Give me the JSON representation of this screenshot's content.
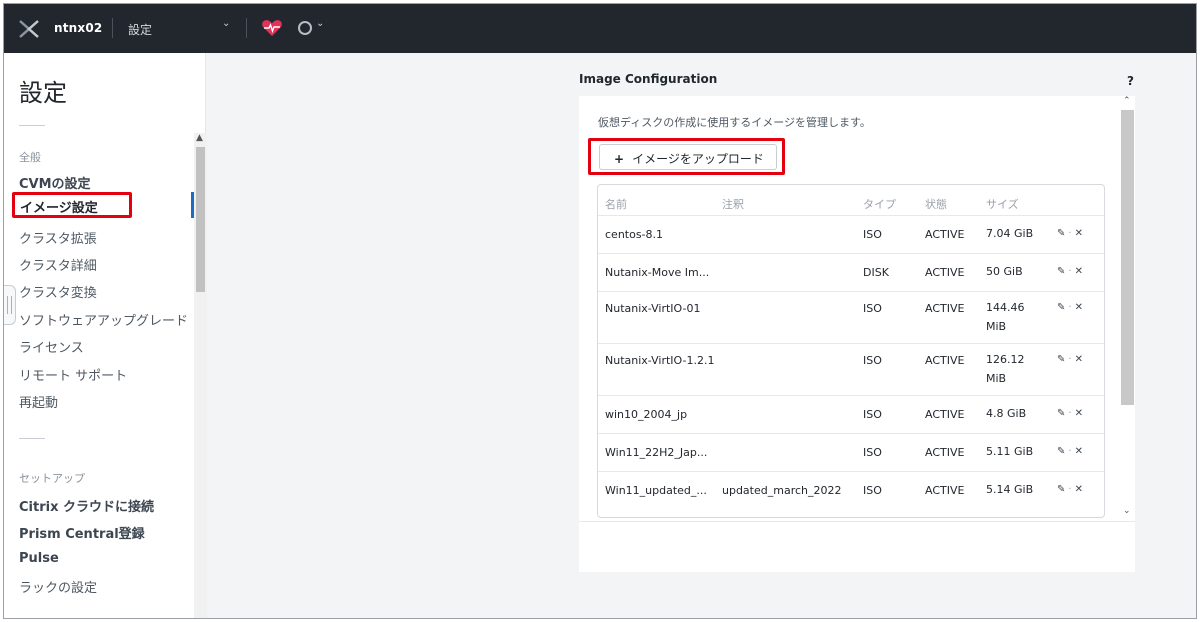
{
  "header": {
    "cluster_name": "ntnx02",
    "page_menu": "設定",
    "caret": "⌄",
    "alert_caret": "⌄",
    "health_color": "#e0335a"
  },
  "sidebar": {
    "title": "設定",
    "group_general": "全般",
    "group_setup": "セットアップ",
    "items": [
      {
        "label": "CVMの設定"
      },
      {
        "label": "イメージ設定"
      },
      {
        "label": "クラスタ拡張"
      },
      {
        "label": "クラスタ詳細"
      },
      {
        "label": "クラスタ変換"
      },
      {
        "label": "ソフトウェアアップグレード"
      },
      {
        "label": "ライセンス"
      },
      {
        "label": "リモート サポート"
      },
      {
        "label": "再起動"
      }
    ],
    "setup_items": [
      {
        "label": "Citrix クラウドに接続"
      },
      {
        "label": "Prism Central登録"
      },
      {
        "label": "Pulse"
      },
      {
        "label": "ラックの設定"
      }
    ],
    "active_color": "#1b6dc1",
    "highlight_color": "#e5000f"
  },
  "main": {
    "panel_title": "Image Configuration",
    "help": "?",
    "description": "仮想ディスクの作成に使用するイメージを管理します。",
    "upload_plus": "+",
    "upload_label": "イメージをアップロード",
    "columns": [
      "名前",
      "注釈",
      "タイプ",
      "状態",
      "サイズ"
    ],
    "rows": [
      {
        "name": "centos-8.1",
        "note": "",
        "type": "ISO",
        "state": "ACTIVE",
        "size": "7.04 GiB"
      },
      {
        "name": "Nutanix-Move Im...",
        "note": "",
        "type": "DISK",
        "state": "ACTIVE",
        "size": "50 GiB"
      },
      {
        "name": "Nutanix-VirtIO-01",
        "note": "",
        "type": "ISO",
        "state": "ACTIVE",
        "size": "144.46 MiB"
      },
      {
        "name": "Nutanix-VirtIO-1.2.1",
        "note": "",
        "type": "ISO",
        "state": "ACTIVE",
        "size": "126.12 MiB"
      },
      {
        "name": "win10_2004_jp",
        "note": "",
        "type": "ISO",
        "state": "ACTIVE",
        "size": "4.8 GiB"
      },
      {
        "name": "Win11_22H2_Jap...",
        "note": "",
        "type": "ISO",
        "state": "ACTIVE",
        "size": "5.11 GiB"
      },
      {
        "name": "Win11_updated_...",
        "note": "updated_march_2022",
        "type": "ISO",
        "state": "ACTIVE",
        "size": "5.14 GiB"
      }
    ],
    "action_edit": "✎",
    "action_dot": "·",
    "action_delete": "✕"
  }
}
